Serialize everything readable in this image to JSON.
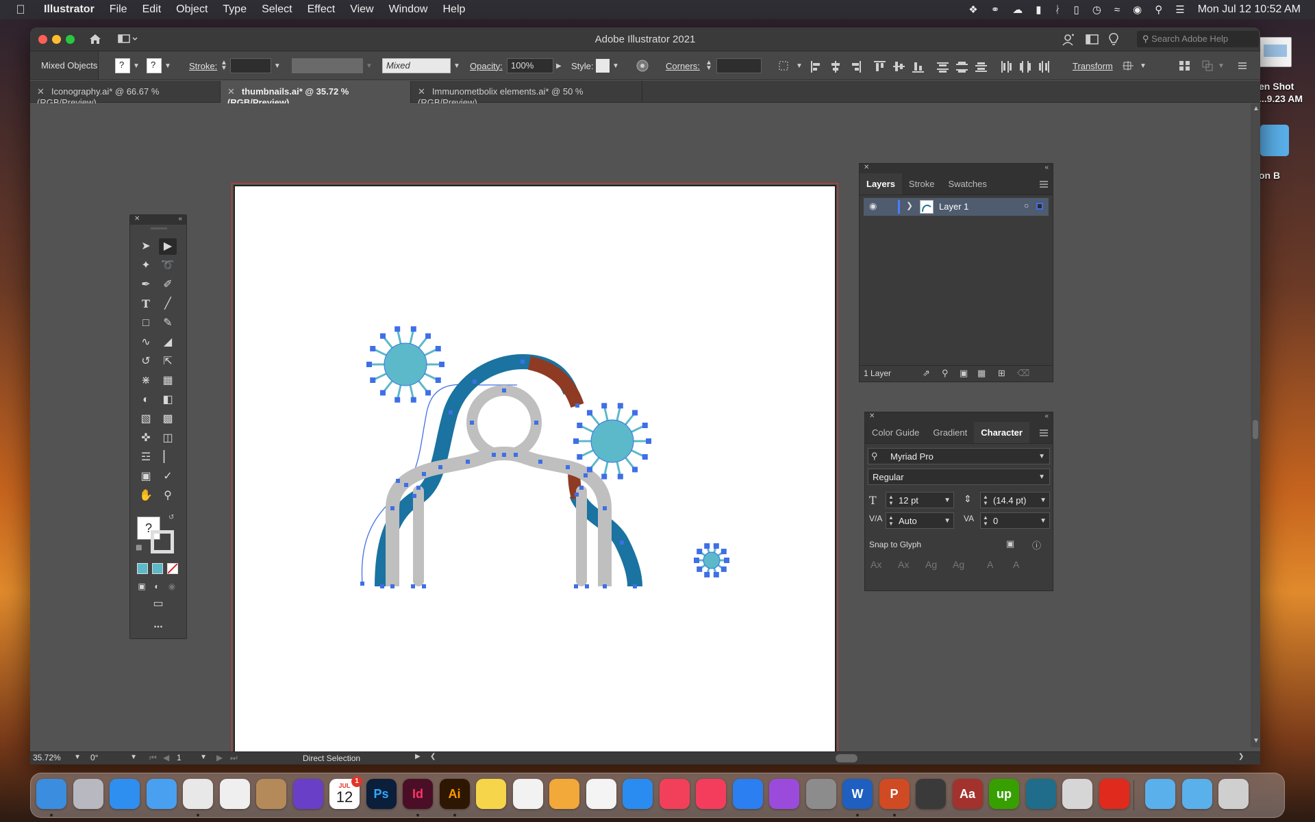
{
  "menubar": {
    "app_name": "Illustrator",
    "menus": [
      "File",
      "Edit",
      "Object",
      "Type",
      "Select",
      "Effect",
      "View",
      "Window",
      "Help"
    ],
    "clock": "Mon Jul 12  10:52 AM",
    "status_icons": [
      "dropbox-icon",
      "creative-cloud-icon",
      "cloud-upload-icon",
      "display-icon",
      "bluetooth-icon",
      "battery-icon",
      "time-machine-icon",
      "wifi-icon",
      "user-icon",
      "search-icon",
      "control-center-icon"
    ]
  },
  "desktop": {
    "screenshot_label_1": "en Shot",
    "screenshot_label_2": "...9.23 AM",
    "folder_label": "on B"
  },
  "window": {
    "title": "Adobe Illustrator 2021",
    "search_placeholder": "Search Adobe Help"
  },
  "controlbar": {
    "selection_type": "Mixed Objects",
    "fill_unknown": "?",
    "stroke_unknown": "?",
    "stroke_label": "Stroke:",
    "brush_value": "Mixed",
    "opacity_label": "Opacity:",
    "opacity_value": "100%",
    "style_label": "Style:",
    "corners_label": "Corners:",
    "transform_label": "Transform"
  },
  "tabs": [
    {
      "label": "Iconography.ai* @ 66.67 % (RGB/Preview)",
      "active": false
    },
    {
      "label": "thumbnails.ai* @ 35.72 % (RGB/Preview)",
      "active": true
    },
    {
      "label": "Immunometbolix elements.ai* @ 50 % (RGB/Preview)",
      "active": false
    }
  ],
  "tools": {
    "fill_unknown": "?",
    "swatch_colors": [
      "#5bb9c9",
      "#5bb9c9"
    ],
    "more": "..."
  },
  "layers_panel": {
    "tabs": [
      "Layers",
      "Stroke",
      "Swatches"
    ],
    "active_tab": "Layers",
    "layer_name": "Layer 1",
    "footer_count": "1 Layer"
  },
  "character_panel": {
    "tabs": [
      "Color Guide",
      "Gradient",
      "Character"
    ],
    "active_tab": "Character",
    "font_family": "Myriad Pro",
    "font_style": "Regular",
    "font_size": "12 pt",
    "leading": "(14.4 pt)",
    "kerning": "Auto",
    "tracking": "0",
    "snap_to_glyph": "Snap to Glyph"
  },
  "statusbar": {
    "zoom": "35.72%",
    "rotation": "0°",
    "artboard_number": "1",
    "current_tool": "Direct Selection"
  },
  "artwork": {
    "colors": {
      "arch_blue": "#1a73a0",
      "body_gray": "#bfbfbf",
      "accent_brown": "#8f3a22",
      "virus_cyan": "#5bb9c9",
      "anchor_blue": "#3f6fe6"
    }
  },
  "dock": {
    "calendar_month": "JUL",
    "calendar_day": "12",
    "calendar_badge": "1",
    "apps": [
      {
        "name": "finder-icon",
        "label": "",
        "color": "#3b8de0"
      },
      {
        "name": "launchpad-icon",
        "label": "",
        "color": "#b8b8c0"
      },
      {
        "name": "safari-icon",
        "label": "",
        "color": "#2e8ff0"
      },
      {
        "name": "mail-icon",
        "label": "",
        "color": "#4aa0f0"
      },
      {
        "name": "chrome-icon",
        "label": "",
        "color": "#e8e8e8"
      },
      {
        "name": "textedit-icon",
        "label": "",
        "color": "#efefef"
      },
      {
        "name": "contacts-icon",
        "label": "",
        "color": "#b58a5a"
      },
      {
        "name": "imovie-icon",
        "label": "",
        "color": "#6a3fc8"
      },
      {
        "name": "calendar-icon",
        "label": "",
        "color": "#ffffff"
      },
      {
        "name": "photoshop-icon",
        "label": "Ps",
        "color": "#0b1e3a"
      },
      {
        "name": "indesign-icon",
        "label": "Id",
        "color": "#4a0f26"
      },
      {
        "name": "illustrator-icon",
        "label": "Ai",
        "color": "#2d1703"
      },
      {
        "name": "notes-icon",
        "label": "",
        "color": "#f7d54a"
      },
      {
        "name": "numbers-icon",
        "label": "",
        "color": "#f2f2f2"
      },
      {
        "name": "pages-icon",
        "label": "",
        "color": "#f2a93a"
      },
      {
        "name": "photos-icon",
        "label": "",
        "color": "#f4f4f4"
      },
      {
        "name": "app-store-icon",
        "label": "",
        "color": "#2a8cf0"
      },
      {
        "name": "news-icon",
        "label": "",
        "color": "#f2405a"
      },
      {
        "name": "music-icon",
        "label": "",
        "color": "#f43d5d"
      },
      {
        "name": "keynote-icon",
        "label": "",
        "color": "#2b7ff0"
      },
      {
        "name": "podcasts-icon",
        "label": "",
        "color": "#9b4bdc"
      },
      {
        "name": "system-preferences-icon",
        "label": "",
        "color": "#8c8c8c"
      },
      {
        "name": "word-icon",
        "label": "W",
        "color": "#1e5fbf"
      },
      {
        "name": "powerpoint-icon",
        "label": "P",
        "color": "#d04a23"
      },
      {
        "name": "calculator-icon",
        "label": "",
        "color": "#3a3a3a"
      },
      {
        "name": "dictionary-icon",
        "label": "Aa",
        "color": "#a3322e"
      },
      {
        "name": "upwork-icon",
        "label": "up",
        "color": "#37a000"
      },
      {
        "name": "camo-icon",
        "label": "",
        "color": "#1f6d8a"
      },
      {
        "name": "preview-icon",
        "label": "",
        "color": "#d6d6d6"
      },
      {
        "name": "acrobat-icon",
        "label": "",
        "color": "#e02a1e"
      },
      {
        "name": "downloads-folder-icon",
        "label": "",
        "color": "#5ab0ea"
      },
      {
        "name": "documents-folder-icon",
        "label": "",
        "color": "#5ab0ea"
      },
      {
        "name": "trash-icon",
        "label": "",
        "color": "#cfcfcf"
      }
    ]
  }
}
